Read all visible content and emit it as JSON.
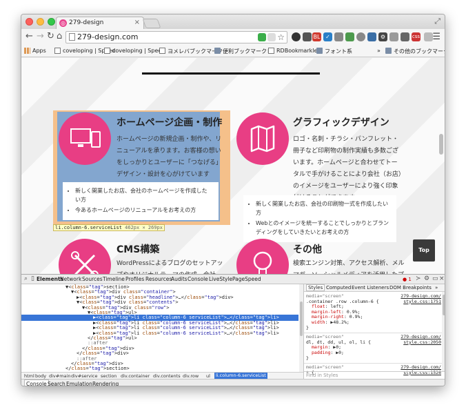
{
  "window": {
    "tab_title": "279-design",
    "tab_favicon": "279"
  },
  "toolbar": {
    "url": "279-design.com",
    "extensions": [
      "BL",
      "css"
    ]
  },
  "bookmarks": [
    {
      "label": "Apps",
      "icon": "grid-icon"
    },
    {
      "label": "coveloping | Speed",
      "icon": "page-icon"
    },
    {
      "label": "coveloping | Speed",
      "icon": "page-icon"
    },
    {
      "label": "ヨメレバブックマーク",
      "icon": "page-icon"
    },
    {
      "label": "便利ブックマークレ",
      "icon": "folder-icon"
    },
    {
      "label": "RDBookmarklet",
      "icon": "page-icon"
    },
    {
      "label": "フォント系",
      "icon": "folder-icon"
    },
    {
      "label": "»",
      "icon": ""
    },
    {
      "label": "その他のブックマーク",
      "icon": "folder-icon"
    }
  ],
  "services": [
    {
      "title": "ホームページ企画・制作",
      "text": "ホームページの新規企画・制作や、リニューアルを承ります。お客様の想いをしっかりとユーザーに「つなげる」デザイン・設計を心がけています",
      "list": [
        "新しく開業したお店、会社のホームページを作成したい方",
        "今あるホームページのリニューアルをお考えの方"
      ],
      "icon": "devices-icon"
    },
    {
      "title": "グラフィックデザイン",
      "text": "ロゴ・名刺・チラシ・パンフレット・冊子など印刷物の制作実績も多数ございます。ホームページと合わせてトータルで手がけることにより会社（お店）のイメージをユーザーにより強く印象付けることができます。",
      "list": [
        "新しく開業したお店、会社の印刷物一式を作成したい方",
        "Webとのイメージを統一することでしっかりとブランディングをしていきたいとお考えの方"
      ],
      "icon": "map-icon"
    },
    {
      "title": "CMS構築",
      "text": "WordPressによるブログのセットアップやオリジナルテーマの作成、会社（お店）のホームページへの組み込みなどをさせていただき",
      "icon": "tools-icon"
    },
    {
      "title": "その他",
      "text": "検索エンジン対策、アクセス解析、メルマガ、ソーシャルメディアを活用したプロモーション、Web広告、特殊な印刷物... お困り",
      "icon": "lightbulb-icon"
    }
  ],
  "inspect_label": {
    "selector": "li.column-6.serviceList",
    "size": "462px × 269px"
  },
  "top_button": "Top",
  "colors": {
    "accent": "#e83e84",
    "overlay": "#6fa1db",
    "margin": "#f5c08a",
    "selection": "#3875d7"
  },
  "devtools": {
    "tabs": [
      "Elements",
      "Network",
      "Sources",
      "Timeline",
      "Profiles",
      "Resources",
      "Audits",
      "Console",
      "LiveStyle",
      "PageSpeed"
    ],
    "error_count": "1",
    "dom_lines": [
      {
        "indent": 1,
        "text": "▼<section>"
      },
      {
        "indent": 2,
        "text": "▼<div class=\"container\">"
      },
      {
        "indent": 3,
        "text": "▶<div class=\"headline\">…</div>"
      },
      {
        "indent": 3,
        "text": "▼<div class=\"contents\">"
      },
      {
        "indent": 4,
        "text": "▼<div class=\"row\">"
      },
      {
        "indent": 5,
        "text": "▼<ul>"
      },
      {
        "indent": 6,
        "text": "▶<li class=\"column-6 serviceList\">…</li>",
        "selected": true
      },
      {
        "indent": 6,
        "text": "▶<li class=\"column-6 serviceList\">…</li>"
      },
      {
        "indent": 6,
        "text": "▶<li class=\"column-6 serviceList\">…</li>"
      },
      {
        "indent": 6,
        "text": "▶<li class=\"column-6 serviceList\">…</li>"
      },
      {
        "indent": 5,
        "text": "</ul>"
      },
      {
        "indent": 5,
        "text": "::after"
      },
      {
        "indent": 4,
        "text": "</div>"
      },
      {
        "indent": 3,
        "text": "</div>"
      },
      {
        "indent": 3,
        "text": "::after"
      },
      {
        "indent": 2,
        "text": "</div>"
      },
      {
        "indent": 1,
        "text": "</section>"
      }
    ],
    "breadcrumbs": [
      "html",
      "body",
      "div#main",
      "div#service",
      "section",
      "div.container",
      "div.contents",
      "div.row",
      "ul",
      "li.column-6.serviceList"
    ],
    "drawer_tabs": [
      "Console",
      "Search",
      "Emulation",
      "Rendering"
    ],
    "styles_tabs": [
      "Styles",
      "Computed",
      "Event Listeners",
      "DOM Breakpoints",
      "»"
    ],
    "style_rules": [
      {
        "media": "media=\"screen\"",
        "source": "279-design.com/",
        "source2": "style.css:1751",
        "selector": ".container .row .column-6 {",
        "props": [
          "float: left;",
          "margin-left: 0.9%;",
          "margin-right: 0.9%;",
          "width: ▶48.2%;"
        ]
      },
      {
        "media": "media=\"screen\"",
        "source": "279-design.com/",
        "source2": "style.css:2050",
        "selector": "dl, dt, dd, ul, ol, li {",
        "props": [
          "margin: ▶0;",
          "padding: ▶0;"
        ]
      },
      {
        "media": "media=\"screen\"",
        "source": "279-design.com/",
        "source2": "style.css:1526",
        "selector": "* {",
        "props": []
      }
    ],
    "find_placeholder": "Find in Styles"
  }
}
